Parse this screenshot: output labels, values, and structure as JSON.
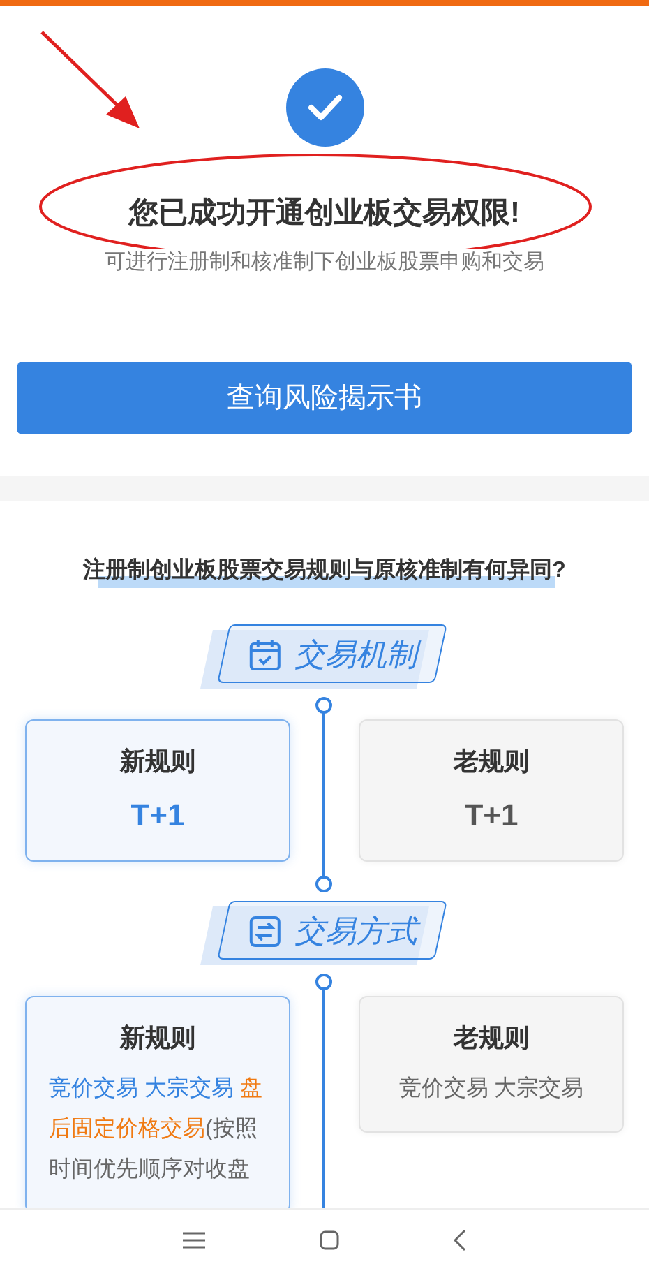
{
  "success": {
    "title": "您已成功开通创业板交易权限!",
    "subtitle": "可进行注册制和核准制下创业板股票申购和交易"
  },
  "risk_button": "查询风险揭示书",
  "comparison": {
    "question": "注册制创业板股票交易规则与原核准制有何异同?",
    "sections": [
      {
        "kind": "calendar",
        "title": "交易机制",
        "new": {
          "label": "新规则",
          "value": "T+1"
        },
        "old": {
          "label": "老规则",
          "value": "T+1"
        }
      },
      {
        "kind": "exchange",
        "title": "交易方式",
        "new": {
          "label": "新规则",
          "segments": [
            {
              "kind": "blue",
              "text": "竞价交易 大宗交易 "
            },
            {
              "kind": "orange",
              "text": "盘后固定价格交易"
            },
            {
              "kind": "plain",
              "text": "(按照时间优先顺序对收盘"
            }
          ]
        },
        "old": {
          "label": "老规则",
          "segments": [
            {
              "kind": "plain",
              "text": "竞价交易 大宗交易"
            }
          ]
        }
      }
    ]
  }
}
